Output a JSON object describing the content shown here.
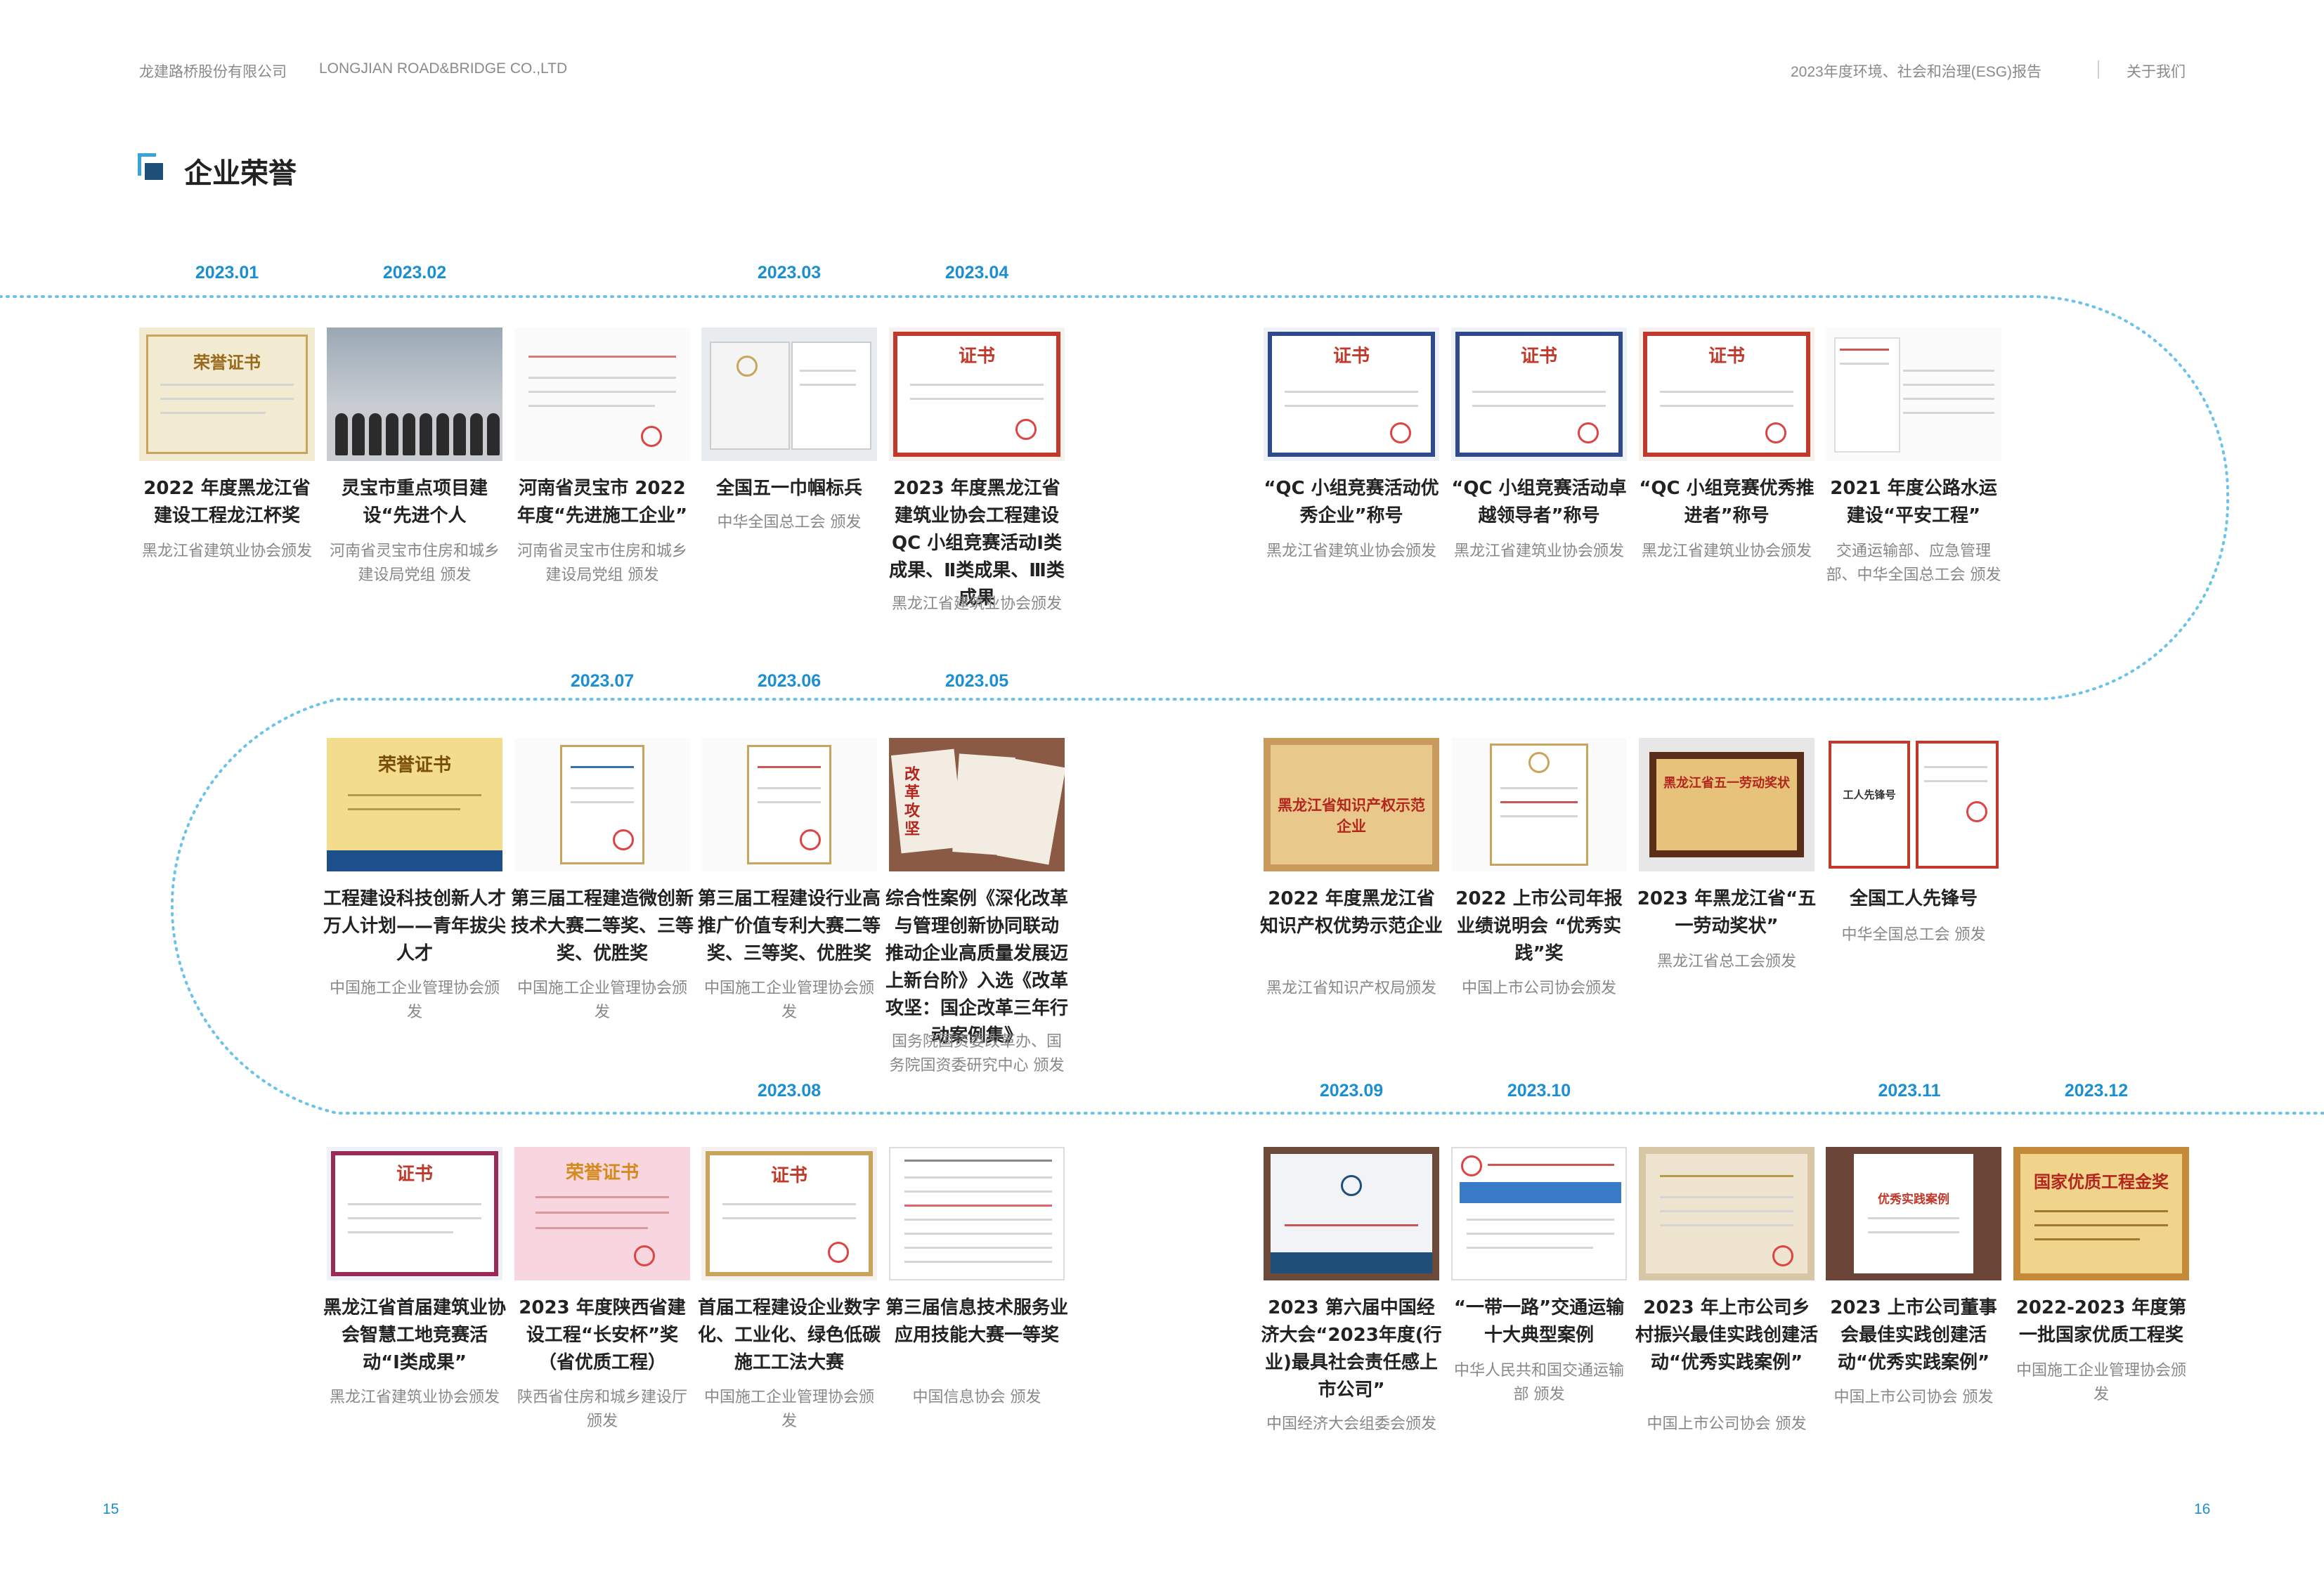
{
  "header": {
    "company_cn": "龙建路桥股份有限公司",
    "company_en": "LONGJIAN ROAD&BRIDGE CO.,LTD",
    "report_title": "2023年度环境、社会和治理(ESG)报告",
    "section": "关于我们"
  },
  "page_title": "企业荣誉",
  "dates": {
    "d2301": "2023.01",
    "d2302": "2023.02",
    "d2303": "2023.03",
    "d2304": "2023.04",
    "d2305": "2023.05",
    "d2306": "2023.06",
    "d2307": "2023.07",
    "d2308": "2023.08",
    "d2309": "2023.09",
    "d2310": "2023.10",
    "d2311": "2023.11",
    "d2312": "2023.12"
  },
  "awards": {
    "a1": {
      "title": "2022 年度黑龙江省建设工程龙江杯奖",
      "org": "黑龙江省建筑业协会颁发",
      "cert_text": "荣誉证书"
    },
    "a2": {
      "title": "灵宝市重点项目建设“先进个人",
      "org": "河南省灵宝市住房和城乡建设局党组 颁发"
    },
    "a3": {
      "title": "河南省灵宝市 2022 年度“先进施工企业”",
      "org": "河南省灵宝市住房和城乡建设局党组 颁发"
    },
    "a4": {
      "title": "全国五一巾帼标兵",
      "org": "中华全国总工会 颁发"
    },
    "a5": {
      "title": "2023 年度黑龙江省建筑业协会工程建设 QC 小组竞赛活动Ⅰ类成果、Ⅱ类成果、Ⅲ类成果",
      "org": "黑龙江省建筑业协会颁发",
      "cert_text": "证书"
    },
    "a6": {
      "title": "“QC 小组竞赛活动优秀企业”称号",
      "org": "黑龙江省建筑业协会颁发",
      "cert_text": "证书"
    },
    "a7": {
      "title": "“QC 小组竞赛活动卓越领导者”称号",
      "org": "黑龙江省建筑业协会颁发",
      "cert_text": "证书"
    },
    "a8": {
      "title": "“QC 小组竞赛优秀推进者”称号",
      "org": "黑龙江省建筑业协会颁发",
      "cert_text": "证书"
    },
    "a9": {
      "title": "2021 年度公路水运建设“平安工程”",
      "org": "交通运输部、应急管理部、中华全国总工会 颁发"
    },
    "b1": {
      "title": "工程建设科技创新人才万人计划——青年拔尖人才",
      "org": "中国施工企业管理协会颁发",
      "cert_text": "荣誉证书"
    },
    "b2": {
      "title": "第三届工程建造微创新技术大赛二等奖、三等奖、优胜奖",
      "org": "中国施工企业管理协会颁发"
    },
    "b3": {
      "title": "第三届工程建设行业高推广价值专利大赛二等奖、三等奖、优胜奖",
      "org": "中国施工企业管理协会颁发"
    },
    "b4": {
      "title": "综合性案例《深化改革与管理创新协同联动 推动企业高质量发展迈上新台阶》入选《改革攻坚：国企改革三年行动案例集》",
      "org": "国务院国资委改革办、国务院国资委研究中心 颁发",
      "cover_text": "改革攻坚"
    },
    "b5": {
      "title": "2022 年度黑龙江省知识产权优势示范企业",
      "org": "黑龙江省知识产权局颁发",
      "plaque_text": "黑龙江省知识产权示范企业"
    },
    "b6": {
      "title": "2022 上市公司年报业绩说明会 “优秀实践”奖",
      "org": "中国上市公司协会颁发"
    },
    "b7": {
      "title": "2023 年黑龙江省“五一劳动奖状”",
      "org": "黑龙江省总工会颁发",
      "plaque_text": "黑龙江省五一劳动奖状"
    },
    "b8": {
      "title": "全国工人先锋号",
      "org": "中华全国总工会 颁发",
      "cert_text": "工人先锋号"
    },
    "c1": {
      "title": "黑龙江省首届建筑业协会智慧工地竞赛活动“I类成果”",
      "org": "黑龙江省建筑业协会颁发",
      "cert_text": "证书"
    },
    "c2": {
      "title": "2023 年度陕西省建设工程“长安杯”奖（省优质工程）",
      "org": "陕西省住房和城乡建设厅 颁发",
      "cert_text": "荣誉证书"
    },
    "c3": {
      "title": "首届工程建设企业数字化、工业化、绿色低碳施工工法大赛",
      "org": "中国施工企业管理协会颁发",
      "cert_text": "证书"
    },
    "c4": {
      "title": "第三届信息技术服务业应用技能大赛一等奖",
      "org": "中国信息协会 颁发"
    },
    "c5": {
      "title": "2023 第六届中国经济大会“2023年度(行业)最具社会责任感上市公司”",
      "org": "中国经济大会组委会颁发"
    },
    "c6": {
      "title": "“一带一路”交通运输十大典型案例",
      "org": "中华人民共和国交通运输部 颁发"
    },
    "c7": {
      "title": "2023 年上市公司乡村振兴最佳实践创建活动“优秀实践案例”",
      "org": "中国上市公司协会 颁发"
    },
    "c8": {
      "title": "2023 上市公司董事会最佳实践创建活动“优秀实践案例”",
      "org": "中国上市公司协会 颁发",
      "cert_text": "优秀实践案例"
    },
    "c9": {
      "title": "2022-2023 年度第一批国家优质工程奖",
      "org": "中国施工企业管理协会颁发",
      "plaque_text": "国家优质工程金奖"
    }
  },
  "page_numbers": {
    "left": "15",
    "right": "16"
  },
  "colors": {
    "accent": "#1b8fd2",
    "navy": "#1f4e79",
    "dotted_path": "#6cc3e8",
    "cert_red": "#c0392b"
  }
}
